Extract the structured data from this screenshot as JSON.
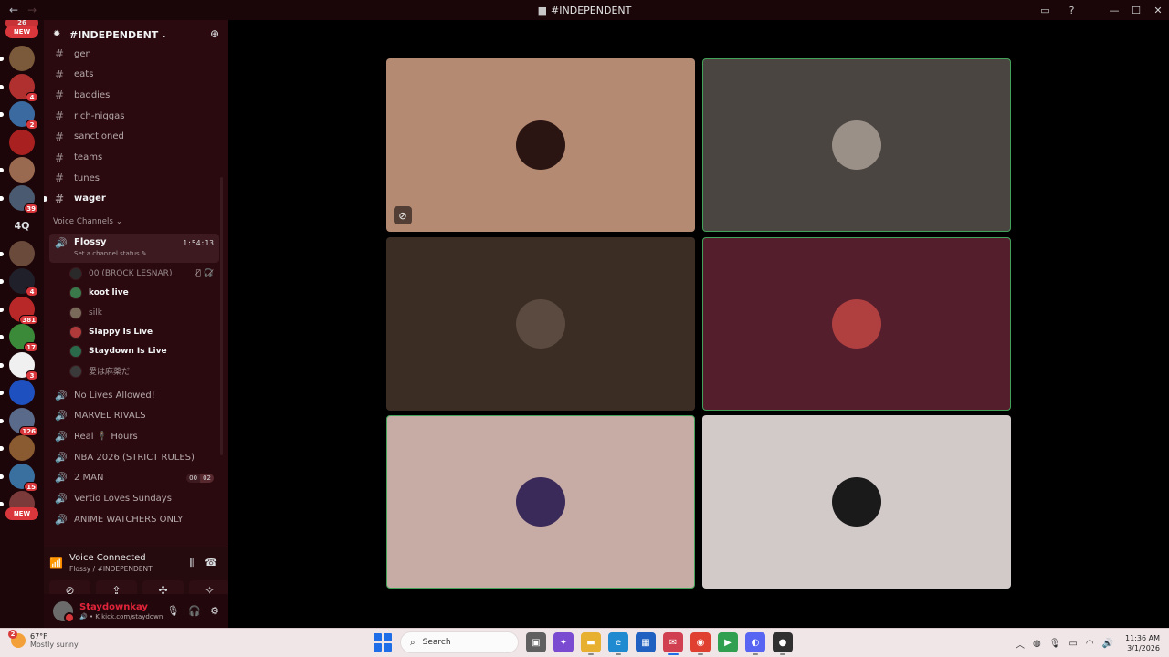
{
  "titlebar": {
    "back_glyph": "←",
    "forward_glyph": "→",
    "title": "#INDEPENDENT",
    "icons": [
      "inbox-icon",
      "help-icon"
    ],
    "window_controls": [
      "—",
      "☐",
      "✕"
    ]
  },
  "rail": {
    "top_badge": "26",
    "new_label": "NEW",
    "servers": [
      {
        "color": "#7a5a3a",
        "badge": "",
        "pill": true
      },
      {
        "color": "#b03030",
        "badge": "4",
        "pill": true
      },
      {
        "color": "#3a6aa0",
        "badge": "2",
        "pill": true
      },
      {
        "color": "#a82020",
        "badge": "",
        "pill": false
      },
      {
        "color": "#9a6a50",
        "badge": "",
        "pill": true
      },
      {
        "color": "#4a5a70",
        "badge": "39",
        "pill": true
      },
      {
        "color": "#1c0609",
        "text": "4Q",
        "badge": "",
        "pill": false
      },
      {
        "color": "#6a4a3a",
        "badge": "",
        "pill": true
      },
      {
        "color": "#20202a",
        "badge": "4",
        "pill": true
      },
      {
        "color": "#b82828",
        "badge": "381",
        "pill": true
      },
      {
        "color": "#3a8a3a",
        "badge": "17",
        "pill": true
      },
      {
        "color": "#f0f0f0",
        "badge": "3",
        "pill": true
      },
      {
        "color": "#1f50c0",
        "badge": "",
        "pill": true
      },
      {
        "color": "#5a6a8a",
        "badge": "126",
        "pill": true
      },
      {
        "color": "#8a5a30",
        "badge": "",
        "pill": true
      },
      {
        "color": "#3a70a0",
        "badge": "15",
        "pill": true
      },
      {
        "color": "#7a3a3a",
        "badge": "",
        "pill": true
      }
    ],
    "bottom_new_label": "NEW"
  },
  "guild": {
    "name": "#INDEPENDENT",
    "chevron": "⌄",
    "invite_glyph": "👤"
  },
  "text_channels": [
    {
      "name": "gen",
      "unread": false
    },
    {
      "name": "eats",
      "unread": false
    },
    {
      "name": "baddies",
      "unread": false
    },
    {
      "name": "rich-niggas",
      "unread": false
    },
    {
      "name": "sanctioned",
      "unread": false
    },
    {
      "name": "teams",
      "unread": false
    },
    {
      "name": "tunes",
      "unread": false
    },
    {
      "name": "wager",
      "unread": true
    }
  ],
  "voice_category": "Voice Channels ⌄",
  "active_voice": {
    "name": "Flossy",
    "timer": "1:54:13",
    "status_hint": "Set a channel status ✎"
  },
  "members": [
    {
      "name": "00 (BROCK LESNAR)",
      "live": false,
      "color": "#2a2a2a",
      "icons": "🎙̸ 🎧̸"
    },
    {
      "name": "koot live",
      "live": true,
      "color": "#3a7a4a",
      "icons": ""
    },
    {
      "name": "silk",
      "live": false,
      "color": "#7a6a5a",
      "icons": ""
    },
    {
      "name": "Slappy Is Live",
      "live": true,
      "color": "#b03a3a",
      "icons": ""
    },
    {
      "name": "Staydown Is Live",
      "live": true,
      "color": "#2a6a4a",
      "icons": ""
    },
    {
      "name": "愛は麻薬だ",
      "live": false,
      "color": "#3a3a3a",
      "icons": ""
    }
  ],
  "voice_channels": [
    {
      "name": "No Lives Allowed!",
      "count_a": "",
      "count_b": ""
    },
    {
      "name": "MARVEL RIVALS",
      "count_a": "",
      "count_b": ""
    },
    {
      "name": "Real 🕴 Hours",
      "count_a": "",
      "count_b": ""
    },
    {
      "name": "NBA 2026 (STRICT RULES)",
      "count_a": "",
      "count_b": ""
    },
    {
      "name": "2 MAN",
      "count_a": "00",
      "count_b": "02"
    },
    {
      "name": "Vertio Loves Sundays",
      "count_a": "",
      "count_b": ""
    },
    {
      "name": "ANIME WATCHERS ONLY",
      "count_a": "",
      "count_b": ""
    }
  ],
  "voice_panel": {
    "status": "Voice Connected",
    "location": "Flossy / #INDEPENDENT",
    "action_icons": [
      "noise-suppression-icon",
      "disconnect-icon"
    ],
    "buttons": [
      "camera-off-icon",
      "screen-share-icon",
      "activities-icon",
      "soundboard-icon"
    ]
  },
  "user": {
    "name": "Staydownkay",
    "status": "kick.com/staydown",
    "status_prefix": "🔊 • K"
  },
  "tiles": [
    {
      "bg": "#b58a73",
      "avatar": "#2a1512",
      "speaking": false,
      "muted": true
    },
    {
      "bg": "#4a4541",
      "avatar": "#9a9088",
      "speaking": true,
      "muted": false
    },
    {
      "bg": "#3b2d24",
      "avatar": "#5a4a40",
      "speaking": false,
      "muted": false
    },
    {
      "bg": "#551e2c",
      "avatar": "#b04040",
      "speaking": true,
      "muted": false
    },
    {
      "bg": "#c7aba5",
      "avatar": "#3a2a5a",
      "speaking": true,
      "muted": false
    },
    {
      "bg": "#d2c9c9",
      "avatar": "#1a1a1a",
      "speaking": false,
      "muted": false
    }
  ],
  "taskbar": {
    "weather_badge": "2",
    "temp": "67°F",
    "condition": "Mostly sunny",
    "search_placeholder": "Search",
    "apps": [
      {
        "name": "task-view-icon",
        "color": "#606060",
        "glyph": "▣",
        "state": ""
      },
      {
        "name": "copilot-icon",
        "color": "#7a4ad0",
        "glyph": "✦",
        "state": ""
      },
      {
        "name": "file-explorer-icon",
        "color": "#e8b030",
        "glyph": "▬",
        "state": "open"
      },
      {
        "name": "edge-icon",
        "color": "#1f8ad0",
        "glyph": "e",
        "state": "open"
      },
      {
        "name": "store-icon",
        "color": "#2060c0",
        "glyph": "▦",
        "state": ""
      },
      {
        "name": "mail-icon",
        "color": "#d04050",
        "glyph": "✉",
        "state": "active"
      },
      {
        "name": "chrome-icon",
        "color": "#e04030",
        "glyph": "◉",
        "state": "open"
      },
      {
        "name": "media-icon",
        "color": "#30a050",
        "glyph": "▶",
        "state": ""
      },
      {
        "name": "discord-icon",
        "color": "#5865f2",
        "glyph": "◐",
        "state": "open"
      },
      {
        "name": "obs-icon",
        "color": "#303030",
        "glyph": "●",
        "state": "open"
      }
    ],
    "time": "11:36 AM",
    "date": "3/1/2026"
  }
}
